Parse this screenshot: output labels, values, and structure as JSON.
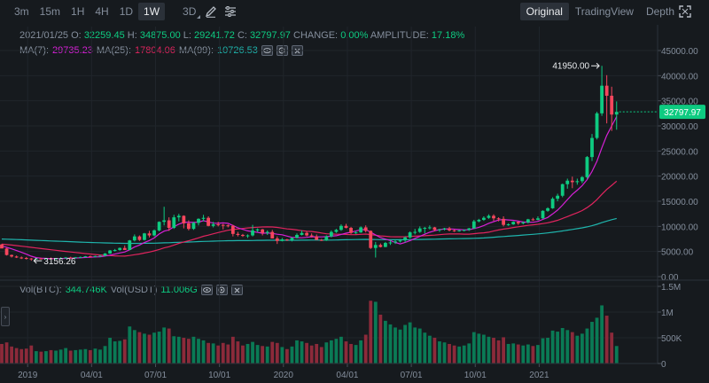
{
  "toolbar": {
    "timeframes": [
      "3m",
      "15m",
      "1H",
      "4H",
      "1D",
      "1W",
      "3D"
    ],
    "active_timeframe": "1W",
    "view_tabs": [
      "Original",
      "TradingView",
      "Depth"
    ],
    "active_view": "Original"
  },
  "info": {
    "date": "2021/01/25",
    "open_label": "O:",
    "open": "32259.45",
    "high_label": "H:",
    "high": "34875.00",
    "low_label": "L:",
    "low": "29241.72",
    "close_label": "C:",
    "close": "32797.97",
    "change_label": "CHANGE:",
    "change": "0.00%",
    "amplitude_label": "AMPLITUDE:",
    "amplitude": "17.18%"
  },
  "ma": {
    "ma7_label": "MA(7):",
    "ma7": "29735.23",
    "ma25_label": "MA(25):",
    "ma25": "17804.06",
    "ma99_label": "MA(99):",
    "ma99": "10726.53"
  },
  "vol": {
    "btc_label": "Vol(BTC):",
    "btc": "344.746K",
    "usdt_label": "Vol(USDT)",
    "usdt": "11.006G"
  },
  "colors": {
    "up": "#0ecb81",
    "down": "#f6465d",
    "up_vol": "#0a7a55",
    "down_vol": "#8c2a3a",
    "ma7": "#d620d6",
    "ma25": "#e0245e",
    "ma99": "#1fb5ad",
    "price_label_bg": "#0ecb81"
  },
  "chart_data": {
    "type": "candlestick",
    "price_axis_ticks": [
      "45000.00",
      "40000.00",
      "35000.00",
      "30000.00",
      "25000.00",
      "20000.00",
      "15000.00",
      "10000.00",
      "5000.00",
      "0.00"
    ],
    "volume_axis_ticks": [
      "1.5M",
      "1M",
      "500K",
      "0"
    ],
    "time_axis_labels": [
      "2019",
      "04/01",
      "07/01",
      "10/01",
      "2020",
      "04/01",
      "07/01",
      "10/01",
      "2021"
    ],
    "price_ylim": [
      0,
      45000
    ],
    "volume_ylim": [
      0,
      1500000
    ],
    "current_price_label": "32797.97",
    "high_annotation": "41950.00",
    "low_annotation": "3156.26",
    "candles": [
      [
        6400,
        6500,
        5900,
        5600
      ],
      [
        5600,
        5700,
        4200,
        4300
      ],
      [
        4300,
        4400,
        3800,
        4000
      ],
      [
        4000,
        4200,
        3700,
        3800
      ],
      [
        3800,
        4000,
        3500,
        3700
      ],
      [
        3700,
        3900,
        3400,
        3600
      ],
      [
        3600,
        3700,
        3156.26,
        3450
      ],
      [
        3450,
        3700,
        3400,
        3600
      ],
      [
        3600,
        3750,
        3450,
        3500
      ],
      [
        3500,
        3700,
        3400,
        3650
      ],
      [
        3650,
        3800,
        3500,
        3580
      ],
      [
        3580,
        3700,
        3450,
        3620
      ],
      [
        3620,
        3850,
        3550,
        3700
      ],
      [
        3700,
        3900,
        3600,
        3800
      ],
      [
        3800,
        3950,
        3650,
        3720
      ],
      [
        3720,
        3900,
        3650,
        3850
      ],
      [
        3850,
        4000,
        3750,
        3900
      ],
      [
        3900,
        4100,
        3800,
        4050
      ],
      [
        4050,
        4200,
        3900,
        3950
      ],
      [
        3950,
        4150,
        3850,
        4100
      ],
      [
        4100,
        4300,
        4000,
        4150
      ],
      [
        4150,
        4700,
        4100,
        4600
      ],
      [
        4600,
        5300,
        4500,
        5200
      ],
      [
        5200,
        5500,
        5000,
        5300
      ],
      [
        5300,
        5800,
        5150,
        5700
      ],
      [
        5700,
        6200,
        5500,
        5300
      ],
      [
        5300,
        7300,
        5250,
        7200
      ],
      [
        7200,
        8400,
        7000,
        8000
      ],
      [
        8000,
        8200,
        7100,
        7300
      ],
      [
        7300,
        8700,
        7200,
        8600
      ],
      [
        8600,
        9100,
        7800,
        8200
      ],
      [
        8200,
        9400,
        8000,
        9200
      ],
      [
        9200,
        11000,
        9000,
        10900
      ],
      [
        10900,
        13900,
        10200,
        11200
      ],
      [
        11200,
        11800,
        9100,
        9700
      ],
      [
        9700,
        12300,
        9500,
        11800
      ],
      [
        11800,
        12500,
        11000,
        12100
      ],
      [
        12100,
        12200,
        9600,
        10600
      ],
      [
        10600,
        11200,
        9200,
        9500
      ],
      [
        9500,
        10900,
        9300,
        10700
      ],
      [
        10700,
        11600,
        10200,
        11500
      ],
      [
        11500,
        12300,
        11000,
        11700
      ],
      [
        11700,
        12000,
        10000,
        10100
      ],
      [
        10100,
        10900,
        9800,
        10400
      ],
      [
        10400,
        10900,
        10000,
        10300
      ],
      [
        10300,
        10500,
        9400,
        10200
      ],
      [
        10200,
        10400,
        9800,
        10100
      ],
      [
        10100,
        10300,
        8000,
        8500
      ],
      [
        8500,
        8900,
        8000,
        8300
      ],
      [
        8300,
        8500,
        7900,
        8100
      ],
      [
        8100,
        8400,
        7700,
        8200
      ],
      [
        8200,
        10300,
        8000,
        9200
      ],
      [
        9200,
        9600,
        8900,
        9400
      ],
      [
        9400,
        9500,
        8200,
        8700
      ],
      [
        8700,
        9200,
        8300,
        8900
      ],
      [
        8900,
        9300,
        7600,
        7600
      ],
      [
        7600,
        8000,
        6500,
        7100
      ],
      [
        7100,
        7700,
        7000,
        7400
      ],
      [
        7400,
        7500,
        7100,
        7300
      ],
      [
        7300,
        7800,
        7000,
        7700
      ],
      [
        7700,
        8600,
        7600,
        8300
      ],
      [
        8300,
        9200,
        8200,
        8700
      ],
      [
        8700,
        9000,
        8000,
        8200
      ],
      [
        8200,
        8600,
        7800,
        8000
      ],
      [
        8000,
        8400,
        7800,
        7300
      ],
      [
        7300,
        7500,
        7100,
        7200
      ],
      [
        7200,
        8200,
        7100,
        8000
      ],
      [
        8000,
        9200,
        7800,
        8900
      ],
      [
        8900,
        9500,
        8700,
        9300
      ],
      [
        9300,
        10400,
        9100,
        10100
      ],
      [
        10100,
        10500,
        9600,
        9700
      ],
      [
        9700,
        9900,
        8500,
        8700
      ],
      [
        8700,
        9100,
        8500,
        8800
      ],
      [
        8800,
        10000,
        8700,
        9800
      ],
      [
        9800,
        10200,
        8800,
        9100
      ],
      [
        9100,
        9200,
        5500,
        5700
      ],
      [
        5700,
        6900,
        3800,
        6300
      ],
      [
        6300,
        6600,
        5800,
        5900
      ],
      [
        5900,
        6900,
        5850,
        6700
      ],
      [
        6700,
        7200,
        6300,
        6800
      ],
      [
        6800,
        7300,
        6500,
        7000
      ],
      [
        7000,
        7500,
        6800,
        7200
      ],
      [
        7200,
        8000,
        6800,
        7800
      ],
      [
        7800,
        9000,
        7600,
        8800
      ],
      [
        8800,
        9500,
        8400,
        8900
      ],
      [
        8900,
        10000,
        8700,
        9600
      ],
      [
        9600,
        9900,
        8600,
        9700
      ],
      [
        9700,
        10200,
        9400,
        9800
      ],
      [
        9800,
        9900,
        9000,
        9300
      ],
      [
        9300,
        9500,
        8900,
        9400
      ],
      [
        9400,
        9700,
        9200,
        9600
      ],
      [
        9600,
        9900,
        9000,
        9200
      ],
      [
        9200,
        9400,
        8900,
        9100
      ],
      [
        9100,
        9300,
        8950,
        9200
      ],
      [
        9200,
        9400,
        9000,
        9300
      ],
      [
        9300,
        9700,
        9100,
        9600
      ],
      [
        9600,
        11300,
        9500,
        11000
      ],
      [
        11000,
        11500,
        10800,
        11300
      ],
      [
        11300,
        12000,
        11100,
        11700
      ],
      [
        11700,
        12400,
        11500,
        12100
      ],
      [
        12100,
        12400,
        11100,
        11600
      ],
      [
        11600,
        11800,
        11000,
        11500
      ],
      [
        11500,
        12000,
        10000,
        10300
      ],
      [
        10300,
        10600,
        10100,
        10400
      ],
      [
        10400,
        11000,
        10300,
        10900
      ],
      [
        10900,
        11000,
        10300,
        10600
      ],
      [
        10600,
        11000,
        10400,
        10800
      ],
      [
        10800,
        11500,
        10600,
        11400
      ],
      [
        11400,
        11700,
        11100,
        11300
      ],
      [
        11300,
        12000,
        11200,
        11600
      ],
      [
        11600,
        13200,
        11500,
        13100
      ],
      [
        13100,
        13800,
        12900,
        13600
      ],
      [
        13600,
        15800,
        13500,
        15500
      ],
      [
        15500,
        16500,
        15000,
        16100
      ],
      [
        16100,
        18500,
        15800,
        18400
      ],
      [
        18400,
        19500,
        17500,
        19100
      ],
      [
        19100,
        19900,
        17600,
        18800
      ],
      [
        18800,
        19500,
        18300,
        19000
      ],
      [
        19000,
        20000,
        18600,
        19800
      ],
      [
        19800,
        24000,
        19500,
        23800
      ],
      [
        23800,
        28400,
        23000,
        27600
      ],
      [
        27600,
        32800,
        27300,
        32500
      ],
      [
        32500,
        41950,
        32000,
        38000
      ],
      [
        38000,
        40100,
        30500,
        36000
      ],
      [
        36000,
        37800,
        29000,
        32259.45
      ],
      [
        32259.45,
        34875,
        29241.72,
        32797.97
      ]
    ],
    "volumes": [
      380000,
      410000,
      330000,
      300000,
      280000,
      290000,
      350000,
      240000,
      230000,
      240000,
      260000,
      250000,
      270000,
      300000,
      250000,
      260000,
      270000,
      280000,
      260000,
      290000,
      270000,
      340000,
      500000,
      430000,
      440000,
      470000,
      720000,
      650000,
      610000,
      580000,
      560000,
      600000,
      620000,
      700000,
      680000,
      530000,
      520000,
      500000,
      480000,
      520000,
      480000,
      450000,
      400000,
      390000,
      350000,
      400000,
      370000,
      520000,
      430000,
      350000,
      380000,
      420000,
      360000,
      340000,
      330000,
      420000,
      400000,
      320000,
      280000,
      330000,
      450000,
      430000,
      400000,
      350000,
      380000,
      320000,
      410000,
      450000,
      480000,
      520000,
      430000,
      380000,
      360000,
      450000,
      560000,
      1220000,
      1200000,
      950000,
      830000,
      760000,
      700000,
      660000,
      750000,
      800000,
      700000,
      680000,
      600000,
      540000,
      500000,
      430000,
      410000,
      380000,
      350000,
      330000,
      350000,
      390000,
      610000,
      580000,
      560000,
      520000,
      500000,
      450000,
      510000,
      380000,
      390000,
      370000,
      350000,
      370000,
      340000,
      360000,
      490000,
      500000,
      640000,
      620000,
      690000,
      650000,
      610000,
      540000,
      580000,
      680000,
      810000,
      890000,
      1130000,
      930000,
      600000,
      340000
    ]
  }
}
